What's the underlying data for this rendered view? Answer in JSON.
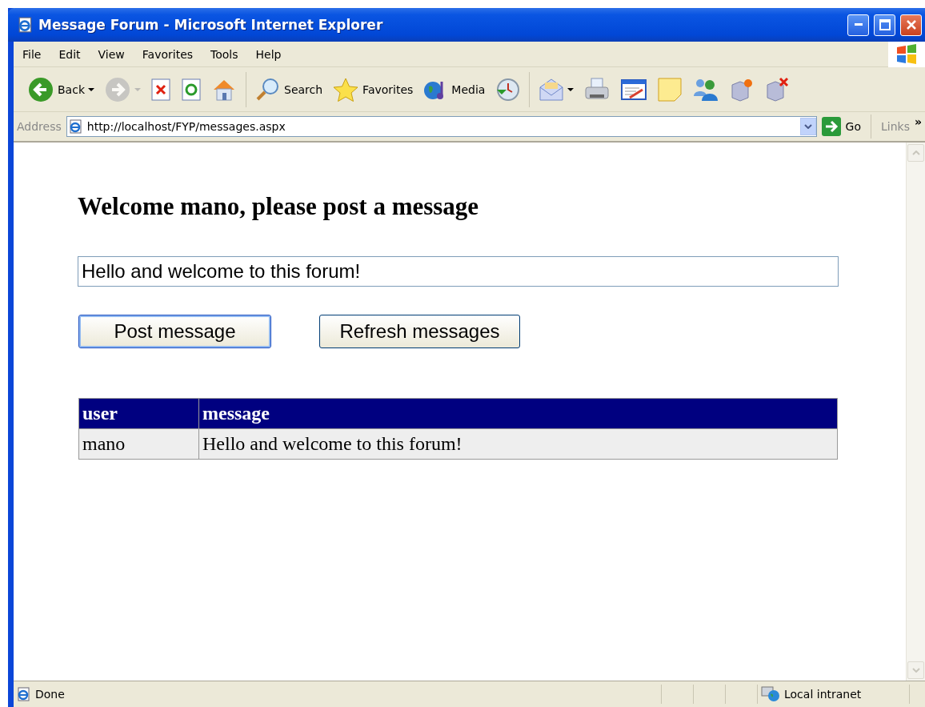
{
  "window": {
    "title": "Message Forum - Microsoft Internet Explorer"
  },
  "menu": [
    "File",
    "Edit",
    "View",
    "Favorites",
    "Tools",
    "Help"
  ],
  "toolbar": [
    [
      {
        "kind": "back",
        "label": "Back",
        "dropdown": true,
        "disabled": false
      },
      {
        "kind": "forward",
        "dropdown": true,
        "disabled": true
      },
      {
        "kind": "stop",
        "disabled": false
      },
      {
        "kind": "refresh",
        "disabled": false
      },
      {
        "kind": "home",
        "disabled": false
      }
    ],
    [
      {
        "kind": "search",
        "label": "Search",
        "disabled": false
      },
      {
        "kind": "favorites",
        "label": "Favorites",
        "disabled": false
      },
      {
        "kind": "media",
        "label": "Media",
        "disabled": false
      },
      {
        "kind": "history",
        "disabled": false
      }
    ],
    [
      {
        "kind": "mail",
        "dropdown": true,
        "disabled": false
      },
      {
        "kind": "print",
        "disabled": false
      },
      {
        "kind": "edit",
        "disabled": false
      },
      {
        "kind": "note",
        "disabled": false
      },
      {
        "kind": "messenger",
        "disabled": false
      },
      {
        "kind": "connect",
        "disabled": false
      },
      {
        "kind": "disconnect",
        "disabled": false
      }
    ]
  ],
  "address": {
    "label": "Address",
    "url": "http://localhost/FYP/messages.aspx",
    "go": "Go",
    "links": "Links",
    "more": "»"
  },
  "page": {
    "heading": "Welcome mano, please post a message",
    "message_input": "Hello and welcome to this forum!",
    "buttons": [
      {
        "label": "Post message",
        "focused": true
      },
      {
        "label": "Refresh messages",
        "focused": false
      }
    ],
    "table": {
      "columns": [
        "user",
        "message"
      ],
      "rows": [
        [
          "mano",
          "Hello and welcome to this forum!"
        ]
      ]
    }
  },
  "status_bar": {
    "text": "Done",
    "zone": "Local intranet"
  }
}
